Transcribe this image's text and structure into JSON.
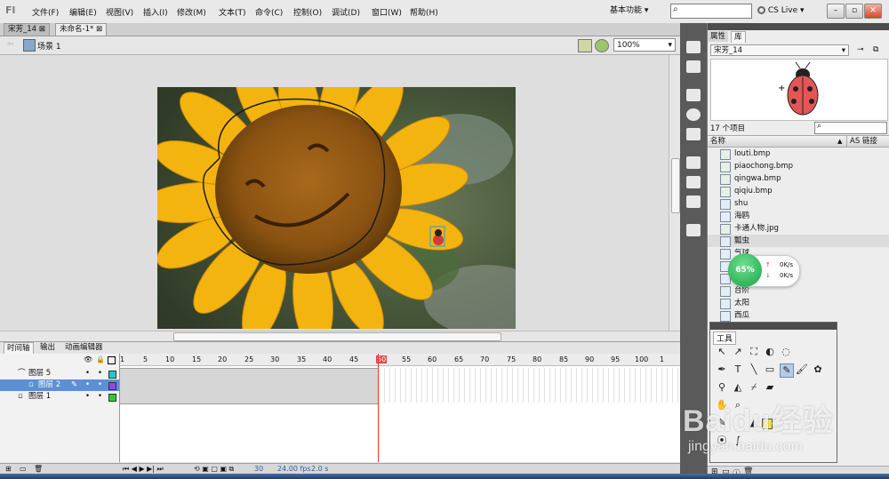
{
  "menubar": {
    "logo": "Fl",
    "items": [
      "文件(F)",
      "编辑(E)",
      "视图(V)",
      "插入(I)",
      "修改(M)",
      "文本(T)",
      "命令(C)",
      "控制(O)",
      "调试(D)",
      "窗口(W)",
      "帮助(H)"
    ],
    "workspace": "基本功能",
    "cs_live": "CS Live",
    "window_buttons": [
      "–",
      "▫",
      "✕"
    ]
  },
  "doc_tabs": [
    "宋芳_14",
    "未命名-1*"
  ],
  "scene": {
    "label": "场景 1",
    "zoom": "100%"
  },
  "timeline": {
    "tabs": [
      "时间轴",
      "输出",
      "动画编辑器"
    ],
    "layers": [
      "图层 5",
      "图层 2",
      "图层 1"
    ],
    "frame_numbers": [
      "1",
      "5",
      "10",
      "15",
      "20",
      "25",
      "30",
      "35",
      "40",
      "45",
      "50",
      "55",
      "60",
      "65",
      "70",
      "75",
      "80",
      "85",
      "90",
      "95",
      "100",
      "1"
    ],
    "status": {
      "frame": "30",
      "fps": "24.00 fps",
      "time": "2.0 s"
    }
  },
  "library": {
    "tabs": [
      "属性",
      "库"
    ],
    "document": "宋芳_14",
    "count": "17 个项目",
    "columns": {
      "name": "名称",
      "linkage": "AS 链接"
    },
    "items": [
      "louti.bmp",
      "piaochong.bmp",
      "qingwa.bmp",
      "qiqiu.bmp",
      "shu",
      "海鸥",
      "卡通人物.jpg",
      "瓢虫",
      "气球",
      "",
      "",
      "台阶",
      "太阳",
      "西瓜"
    ]
  },
  "netspeed": {
    "percent": "65%",
    "up": "0K/s",
    "down": "0K/s"
  },
  "tools": {
    "title": "工具"
  },
  "watermark": {
    "brand": "Baidu经验",
    "url": "jingyan.baidu.com"
  }
}
